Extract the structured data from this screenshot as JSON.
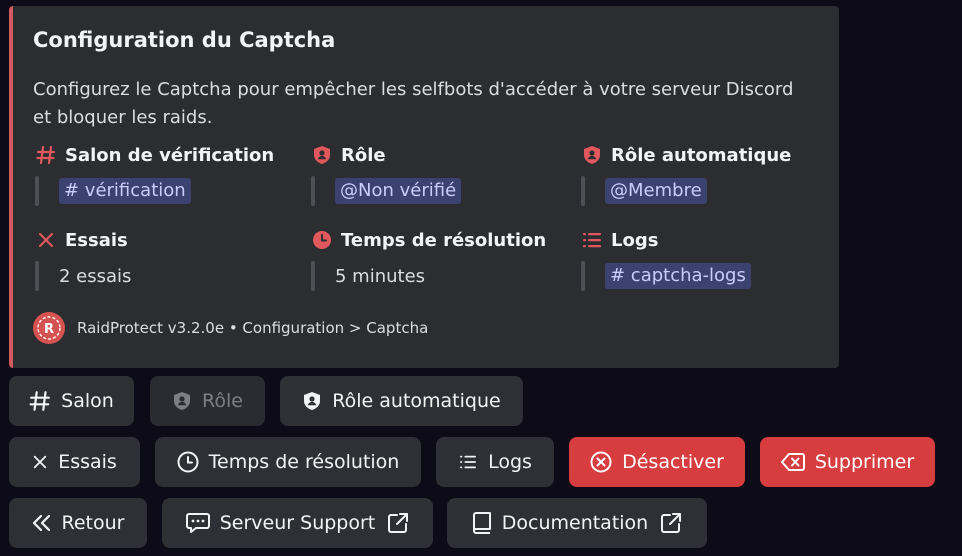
{
  "embed": {
    "accent_color": "#d35a5f",
    "title": "Configuration du Captcha",
    "description": "Configurez le Captcha pour empêcher les selfbots d'accéder à votre serveur Discord et bloquer les raids.",
    "fields": [
      {
        "name": "Salon de vérification",
        "icon": "hash-icon",
        "value": "# vérification",
        "mention": true
      },
      {
        "name": "Rôle",
        "icon": "shield-user-icon",
        "value": "@Non vérifié",
        "mention": true
      },
      {
        "name": "Rôle automatique",
        "icon": "shield-user-icon",
        "value": "@Membre",
        "mention": true
      },
      {
        "name": "Essais",
        "icon": "x-icon",
        "value": "2 essais",
        "mention": false
      },
      {
        "name": "Temps de résolution",
        "icon": "clock-icon",
        "value": "5 minutes",
        "mention": false
      },
      {
        "name": "Logs",
        "icon": "list-icon",
        "value": "# captcha-logs",
        "mention": true
      }
    ],
    "footer": {
      "text": "RaidProtect v3.2.0e • Configuration > Captcha",
      "avatar_letter": "R"
    }
  },
  "buttons": {
    "row1": [
      {
        "label": "Salon",
        "icon": "hash-icon",
        "disabled": false
      },
      {
        "label": "Rôle",
        "icon": "shield-user-icon",
        "disabled": true
      },
      {
        "label": "Rôle automatique",
        "icon": "shield-user-icon",
        "disabled": false
      }
    ],
    "row2": [
      {
        "label": "Essais",
        "icon": "x-icon",
        "style": "secondary"
      },
      {
        "label": "Temps de résolution",
        "icon": "clock-icon",
        "style": "secondary"
      },
      {
        "label": "Logs",
        "icon": "list-icon",
        "style": "secondary"
      },
      {
        "label": "Désactiver",
        "icon": "circle-x-icon",
        "style": "danger"
      },
      {
        "label": "Supprimer",
        "icon": "backspace-icon",
        "style": "danger"
      }
    ],
    "row3": [
      {
        "label": "Retour",
        "icon": "double-chevron-left-icon",
        "external": false
      },
      {
        "label": "Serveur Support",
        "icon": "chat-icon",
        "external": true
      },
      {
        "label": "Documentation",
        "icon": "book-icon",
        "external": true
      }
    ]
  },
  "colors": {
    "background": "#0c0b17",
    "embed_bg": "#2b2d31",
    "button_bg": "#2e3035",
    "danger": "#d73c3f",
    "mention_bg": "#3c4270",
    "mention_text": "#c9cdfb",
    "icon_red": "#e0585c"
  }
}
